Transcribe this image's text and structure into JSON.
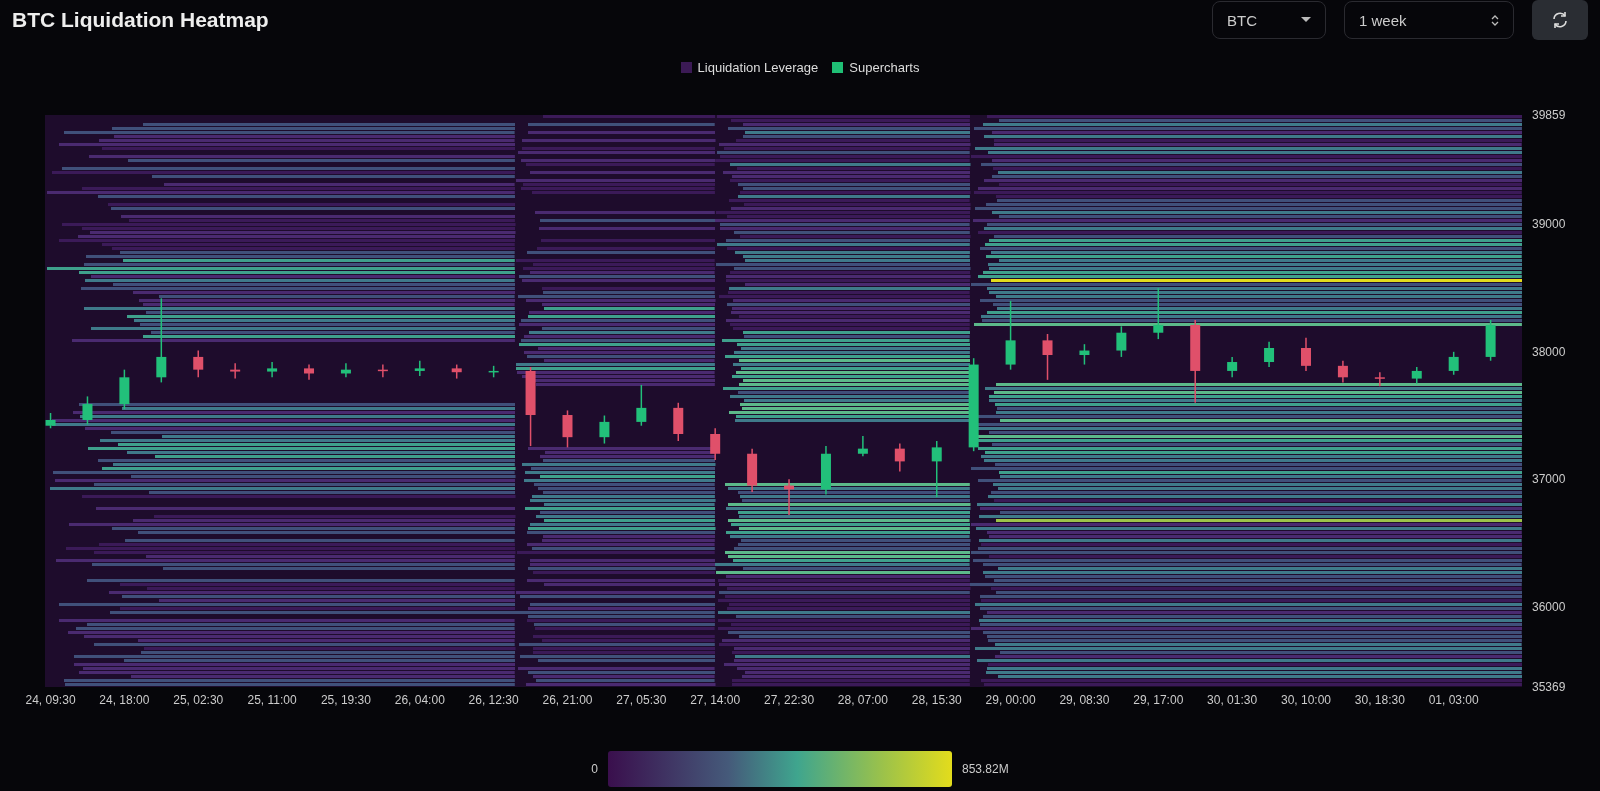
{
  "title": "BTC Liquidation Heatmap",
  "controls": {
    "symbol": "BTC",
    "range": "1 week"
  },
  "legend": [
    {
      "label": "Liquidation Leverage",
      "color": "#3b1a55"
    },
    {
      "label": "Supercharts",
      "color": "#1fbf75"
    }
  ],
  "chart_data": {
    "type": "candlestick",
    "ylim": [
      35369,
      39859
    ],
    "yticks": [
      {
        "value": 39859,
        "label": "39859"
      },
      {
        "value": 39000,
        "label": "39000"
      },
      {
        "value": 38000,
        "label": "38000"
      },
      {
        "value": 37000,
        "label": "37000"
      },
      {
        "value": 36000,
        "label": "36000"
      },
      {
        "value": 35369,
        "label": "35369"
      }
    ],
    "categories": [
      "24, 09:30",
      null,
      "24, 18:00",
      null,
      "25, 02:30",
      null,
      "25, 11:00",
      null,
      "25, 19:30",
      null,
      "26, 04:00",
      null,
      "26, 12:30",
      null,
      "26, 21:00",
      null,
      "27, 05:30",
      null,
      "27, 14:00",
      null,
      "27, 22:30",
      null,
      "28, 07:00",
      null,
      "28, 15:30",
      null,
      "29, 00:00",
      null,
      "29, 08:30",
      null,
      "29, 17:00",
      null,
      "30, 01:30",
      null,
      "30, 10:00",
      null,
      "30, 18:30",
      null,
      "01, 03:00",
      null
    ],
    "ohlc": [
      [
        37420,
        37520,
        37400,
        37465
      ],
      [
        37465,
        37650,
        37430,
        37590
      ],
      [
        37590,
        37860,
        37550,
        37800
      ],
      [
        37800,
        38420,
        37760,
        37960
      ],
      [
        37960,
        38010,
        37800,
        37860
      ],
      [
        37860,
        37910,
        37790,
        37845
      ],
      [
        37845,
        37920,
        37800,
        37870
      ],
      [
        37870,
        37900,
        37780,
        37830
      ],
      [
        37830,
        37910,
        37800,
        37860
      ],
      [
        37860,
        37900,
        37800,
        37850
      ],
      [
        37850,
        37930,
        37810,
        37870
      ],
      [
        37870,
        37900,
        37790,
        37840
      ],
      [
        37840,
        37890,
        37800,
        37850
      ],
      [
        37850,
        37880,
        37260,
        37504
      ],
      [
        37504,
        37540,
        37250,
        37330
      ],
      [
        37330,
        37500,
        37280,
        37450
      ],
      [
        37450,
        37740,
        37420,
        37560
      ],
      [
        37560,
        37600,
        37300,
        37355
      ],
      [
        37355,
        37400,
        37150,
        37200
      ],
      [
        37200,
        37240,
        36900,
        36950
      ],
      [
        36950,
        37000,
        36720,
        36920
      ],
      [
        36920,
        37260,
        36880,
        37200
      ],
      [
        37200,
        37340,
        37180,
        37240
      ],
      [
        37240,
        37280,
        37060,
        37140
      ],
      [
        37140,
        37300,
        36860,
        37250
      ],
      [
        37250,
        37950,
        37220,
        37900
      ],
      [
        37900,
        38400,
        37860,
        38090
      ],
      [
        38090,
        38140,
        37780,
        37975
      ],
      [
        37975,
        38060,
        37900,
        38010
      ],
      [
        38010,
        38200,
        37960,
        38150
      ],
      [
        38150,
        38500,
        38100,
        38211
      ],
      [
        38211,
        38250,
        37600,
        37850
      ],
      [
        37850,
        37960,
        37800,
        37920
      ],
      [
        37920,
        38080,
        37880,
        38030
      ],
      [
        38030,
        38110,
        37850,
        37890
      ],
      [
        37890,
        37930,
        37760,
        37800
      ],
      [
        37800,
        37840,
        37730,
        37790
      ],
      [
        37790,
        37880,
        37750,
        37850
      ],
      [
        37850,
        38000,
        37820,
        37960
      ],
      [
        37960,
        38250,
        37930,
        38210
      ]
    ]
  },
  "scale": {
    "min": "0",
    "max": "853.82M"
  }
}
